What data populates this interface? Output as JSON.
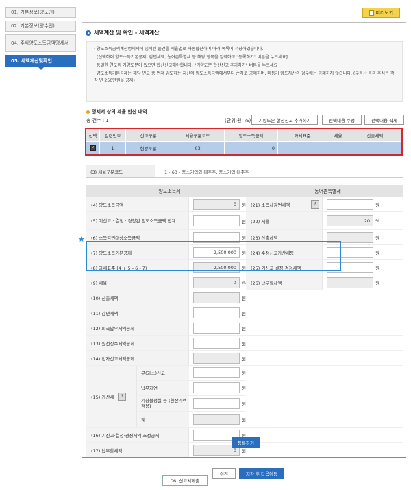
{
  "sidebar": {
    "items": [
      {
        "label": "01. 기본정보(양도인)"
      },
      {
        "label": "02. 기본정보(양수인)"
      },
      {
        "label": "04. 주식양도소득금액명세서"
      },
      {
        "label": "05. 세액계산및확인"
      },
      {
        "label": "06. 신고서제출"
      }
    ]
  },
  "header": {
    "preview_label": "미리보기",
    "title": "세액계산 및 확인 - 세액계산"
  },
  "notice": {
    "lines": [
      "· 양도소득금액계산명세서에 입력된 물건을 세율별로 자동합산하여 아래 목록에 저장하였습니다.",
      "[선택하여 양도소득기본공제, 감면세액, 농어촌특별세 등 해당 항목을 입력하고 \"등록하기\" 버튼을 누르세요]",
      "· 동일한 연도의 기양도분이 있으면 합산신고해야합니다. \"기양도분 합산신고 추가하기\" 버튼을 누르세요",
      "· 양도소득기본공제는 해당 연도 중 먼저 양도하는 자산의 양도소득금액에서부터 순차로 공제하며, 미등기 양도자산의 경우에는 공제하지 않습니다. (부동산 등과 주식은 각각 연 250만원을 공제)"
    ]
  },
  "summary": {
    "section_title": "명세서 상의 세율 합산 내역",
    "count_label": "총 건수 : 1",
    "unit_label": "(단위:원, %)",
    "add_prior_button": "기양도분 합산신고 추가하기",
    "edit_button": "선택내용 수정",
    "delete_button": "선택내용 삭제",
    "columns": [
      "선택",
      "일련번호",
      "신고구분",
      "세율구분코드",
      "양도소득금액",
      "과세표준",
      "세율",
      "산출세액"
    ],
    "rows": [
      {
        "check": "✓",
        "no": "1",
        "type": "현양도분",
        "rate_code": "63",
        "income": "0",
        "base": "",
        "rate": "",
        "tax": ""
      }
    ]
  },
  "rate_code": {
    "label": "(3) 세율구분코드",
    "value": "1 - 63 - 중소기업외 대주주, 중소기업 대주주"
  },
  "form": {
    "left_header": "양도소득세",
    "right_header": "농어촌특별세",
    "unit_won": "원",
    "unit_pct": "%",
    "f4": {
      "label": "(4) 양도소득금액",
      "value": "0"
    },
    "f5": {
      "label": "(5) 기신고 · 결정 · 경정된 양도소득금액 합계",
      "value": ""
    },
    "f6": {
      "label": "(6) 소득감면대상소득금액",
      "value": ""
    },
    "f7": {
      "label": "(7) 양도소득기본공제",
      "value": "2,500,000"
    },
    "f8": {
      "label": "(8) 과세표준 (4 + 5 - 6 - 7)",
      "value": "-2,500,000"
    },
    "f9": {
      "label": "(9) 세율",
      "value": "0"
    },
    "f10": {
      "label": "(10) 산출세액",
      "value": ""
    },
    "f11": {
      "label": "(11) 감면세액",
      "value": ""
    },
    "f12": {
      "label": "(12) 외국납부세액공제",
      "value": ""
    },
    "f13": {
      "label": "(13) 원천징수세액공제",
      "value": ""
    },
    "f14": {
      "label": "(14) 전자신고세액공제",
      "value": ""
    },
    "f15": {
      "label": "(15) 가산세",
      "q": "?",
      "sub": [
        {
          "label": "무(과소)신고",
          "value": ""
        },
        {
          "label": "납부지연",
          "value": ""
        },
        {
          "label": "기장불성실 등 (환산가액 적용)",
          "value": ""
        },
        {
          "label": "계",
          "value": ""
        }
      ]
    },
    "f16": {
      "label": "(16) 기신고·결정·경정세액,조정공제",
      "value": ""
    },
    "f17": {
      "label": "(17) 납부할세액",
      "value": "0"
    },
    "r21": {
      "label": "(21) 소득세감면세액",
      "q": "?",
      "value": ""
    },
    "r22": {
      "label": "(22) 세율",
      "value": "20"
    },
    "r23": {
      "label": "(23) 산출세액",
      "value": ""
    },
    "r24": {
      "label": "(24) 수정신고가산세등",
      "value": ""
    },
    "r25": {
      "label": "(25) 기신고·결정·경정세액",
      "value": ""
    },
    "r26": {
      "label": "(26) 납부할세액",
      "value": ""
    }
  },
  "actions": {
    "register": "등록하기",
    "prev": "이전",
    "save_next": "저장 후 다음이동"
  }
}
